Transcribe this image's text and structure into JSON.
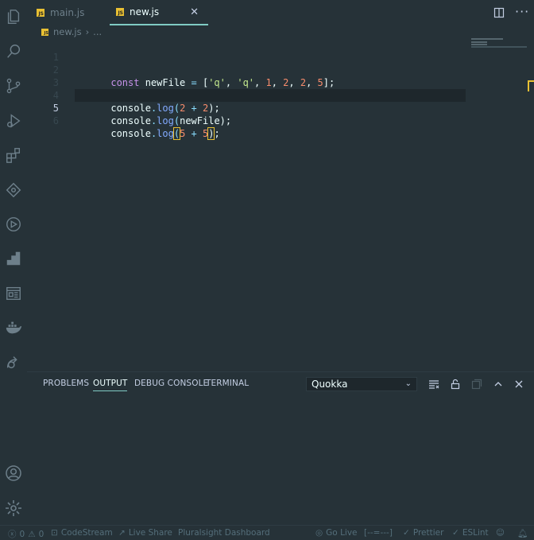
{
  "tabs": [
    {
      "label": "main.js",
      "active": false
    },
    {
      "label": "new.js",
      "active": true
    }
  ],
  "tab_close_glyph": "✕",
  "breadcrumb": {
    "file": "new.js",
    "separator": "›",
    "rest": "..."
  },
  "editor": {
    "lines": [
      {
        "n": "1"
      },
      {
        "n": "2"
      },
      {
        "n": "3"
      },
      {
        "n": "4"
      },
      {
        "n": "5"
      },
      {
        "n": "6"
      }
    ],
    "line1": {
      "kw": "const",
      "name": " newFile ",
      "eq": "= ",
      "open": "[",
      "s1": "'q'",
      "c1": ", ",
      "s2": "'q'",
      "c2": ", ",
      "n1": "1",
      "c3": ", ",
      "n2": "2",
      "c4": ", ",
      "n3": "2",
      "c5": ", ",
      "n4": "5",
      "close": "];"
    },
    "line3": {
      "obj": "console",
      "dot": ".",
      "fn": "log",
      "open": "(",
      "a": "2",
      "op": " + ",
      "b": "2",
      "close": ");"
    },
    "line4": {
      "obj": "console",
      "dot": ".",
      "fn": "log",
      "open": "(",
      "arg": "newFile",
      "close": ");"
    },
    "line5": {
      "obj": "console",
      "dot": ".",
      "fn": "log",
      "open": "(",
      "a": "5",
      "op": " + ",
      "b": "5",
      "close": ")",
      "semi": ";"
    }
  },
  "panel": {
    "tabs": [
      "PROBLEMS",
      "OUTPUT",
      "DEBUG CONSOLE",
      "TERMINAL"
    ],
    "active_tab": "OUTPUT",
    "output_channel": "Quokka"
  },
  "status": {
    "errors": "0",
    "warnings": "0",
    "codestream": "CodeStream",
    "liveshare": "Live Share",
    "pluralsight": "Pluralsight Dashboard",
    "golive": "Go Live",
    "dashes": "[--=---]",
    "prettier": "Prettier",
    "eslint": "ESLint"
  },
  "colors": {
    "accent": "#80cbc4",
    "background": "#263238",
    "js_badge": "#e8c033"
  }
}
